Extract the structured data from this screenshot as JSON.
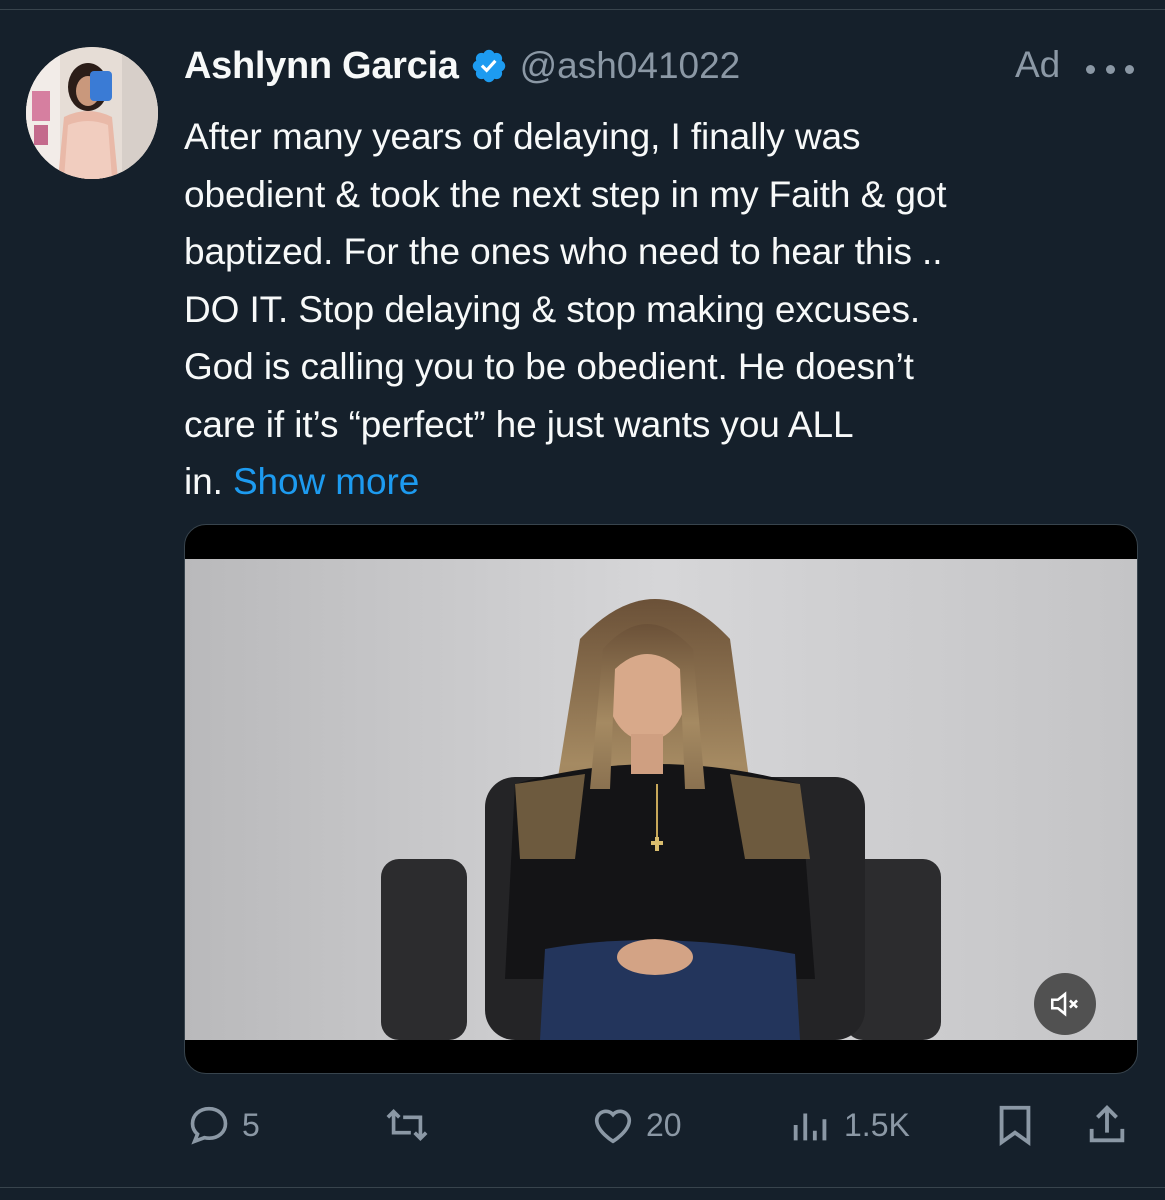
{
  "author": {
    "name": "Ashlynn Garcia",
    "handle": "@ash041022",
    "verified": true
  },
  "ad_label": "Ad",
  "tweet": {
    "lines": [
      "After many years of delaying, I finally was",
      "obedient & took the next step in my Faith & got",
      "baptized. For the ones who need to hear this ..",
      "DO IT. Stop delaying & stop making excuses.",
      "God is calling you to be obedient. He doesn’t",
      "care if it’s “perfect” he just wants you ALL"
    ],
    "last_line_text": "in.",
    "show_more": "Show more"
  },
  "media": {
    "type": "video",
    "muted": true,
    "mute_icon": "speaker-muted-icon"
  },
  "actions": {
    "reply": {
      "icon": "reply-icon",
      "count": "5"
    },
    "retweet": {
      "icon": "retweet-icon",
      "count": ""
    },
    "like": {
      "icon": "heart-icon",
      "count": "20"
    },
    "views": {
      "icon": "views-chart-icon",
      "count": "1.5K"
    },
    "bookmark": {
      "icon": "bookmark-icon"
    },
    "share": {
      "icon": "share-icon"
    }
  },
  "colors": {
    "background": "#15202b",
    "text_primary": "#f7f9f9",
    "text_secondary": "#8b98a5",
    "accent": "#1d9bf0",
    "divider": "#38444d"
  }
}
